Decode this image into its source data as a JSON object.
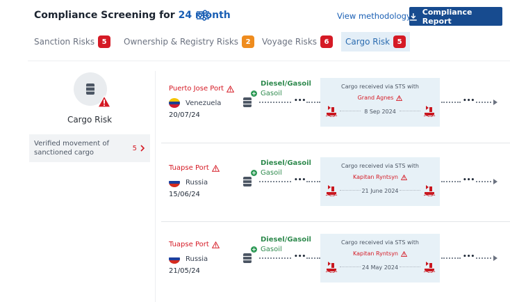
{
  "header": {
    "title_prefix": "Compliance Screening for",
    "title_period": "24 month",
    "filter_icon": "sliders-icon",
    "methodology_link": "View methodology",
    "report_button": "Compliance Report",
    "report_icon": "download-icon"
  },
  "tabs": [
    {
      "label": "Sanction Risks",
      "count": "5",
      "color": "#d51a25",
      "active": false
    },
    {
      "label": "Ownership & Registry Risks",
      "count": "2",
      "color": "#ef8c1e",
      "active": false
    },
    {
      "label": "Voyage Risks",
      "count": "6",
      "color": "#d51a25",
      "active": false
    },
    {
      "label": "Cargo Risk",
      "count": "5",
      "color": "#d51a25",
      "active": true
    }
  ],
  "summary": {
    "icon": "barrel-warning-icon",
    "label": "Cargo Risk",
    "verified_text": "Verified movement of sanctioned cargo",
    "verified_count": "5"
  },
  "records": [
    {
      "port": "Puerto Jose Port",
      "country": "Venezuela",
      "flag_colors": [
        "#f5c400",
        "#1e3f8f",
        "#cf1d2e"
      ],
      "date": "20/07/24",
      "cargo": "Diesel/Gasoil",
      "cargo_sub": "Gasoil",
      "sts_head": "Cargo received via STS with",
      "sts_vessel": "Grand Agnes",
      "sts_date": "8 Sep 2024"
    },
    {
      "port": "Tuapse Port",
      "country": "Russia",
      "flag_colors": [
        "#ffffff",
        "#1c3f9e",
        "#d52b1e"
      ],
      "date": "15/06/24",
      "cargo": "Diesel/Gasoil",
      "cargo_sub": "Gasoil",
      "sts_head": "Cargo received via STS with",
      "sts_vessel": "Kapitan Ryntsyn",
      "sts_date": "21 June 2024"
    },
    {
      "port": "Tuapse Port",
      "country": "Russia",
      "flag_colors": [
        "#ffffff",
        "#1c3f9e",
        "#d52b1e"
      ],
      "date": "21/05/24",
      "cargo": "Diesel/Gasoil",
      "cargo_sub": "Gasoil",
      "sts_head": "Cargo received via STS with",
      "sts_vessel": "Kapitan Ryntsyn",
      "sts_date": "24 May 2024"
    }
  ],
  "colors": {
    "brand_blue": "#174b8f",
    "link_blue": "#1a5fb4",
    "risk_red": "#d51a25",
    "cargo_green": "#2f8a4e",
    "sts_bg": "#e7f1f7"
  }
}
